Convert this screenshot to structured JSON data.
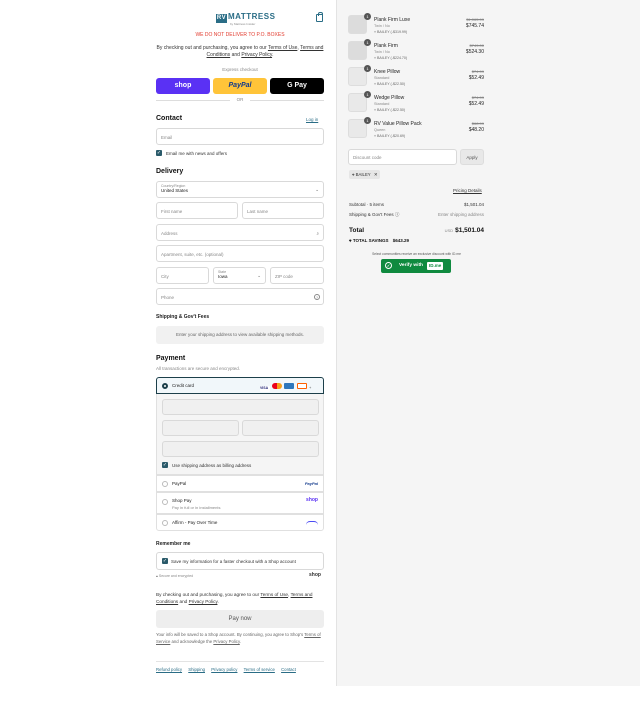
{
  "brand": {
    "name": "MATTRESS",
    "mark": "RV",
    "subtitle": "by Mattress Insider"
  },
  "notice": "WE DO NOT DELIVER TO P.O. BOXES",
  "agree_top": {
    "pre": "By checking out and purchasing, you agree to our",
    "terms": "Terms of Use",
    "mid": ", ",
    "terms2": "Terms and Conditions",
    "and": "and",
    "privacy": "Privacy Policy",
    "end": "."
  },
  "express": {
    "label": "Express checkout",
    "shop": "shop",
    "paypal": "PayPal",
    "gpay": "G Pay",
    "or": "OR"
  },
  "contact": {
    "title": "Contact",
    "login": "Log in",
    "email_placeholder": "Email",
    "news_label": "Email me with news and offers"
  },
  "delivery": {
    "title": "Delivery",
    "country_label": "Country/Region",
    "country_value": "United States",
    "first_name": "First name",
    "last_name": "Last name",
    "address": "Address",
    "apartment": "Apartment, suite, etc. (optional)",
    "city": "City",
    "state_label": "State",
    "state_value": "Iowa",
    "zip": "ZIP code",
    "phone": "Phone"
  },
  "shipping": {
    "title": "Shipping & Gov't Fees",
    "message": "Enter your shipping address to view available shipping methods."
  },
  "payment": {
    "title": "Payment",
    "subtitle": "All transactions are secure and encrypted.",
    "credit_card": "Credit card",
    "billing_label": "Use shipping address as billing address",
    "paypal": "PayPal",
    "shop_pay": "Shop Pay",
    "shop_pay_sub": "Pay in full or in installments",
    "affirm": "Affirm - Pay Over Time",
    "card_colors": [
      "#1a1f71",
      "#eb001b",
      "#2e77bc",
      "#ff6000"
    ]
  },
  "remember": {
    "title": "Remember me",
    "label": "Save my information for a faster checkout with a Shop account",
    "secure": "Secure and encrypted",
    "shop": "shop"
  },
  "agree_bottom": {
    "pre": "By checking out and purchasing, you agree to our",
    "terms": "Terms of Use",
    "and1": ", ",
    "terms2": "Terms and Conditions",
    "and": "and",
    "privacy": "Privacy Policy",
    "end": "."
  },
  "pay_now": "Pay now",
  "shop_info": {
    "pre": "Your info will be saved to a Shop account. By continuing, you agree to Shop's",
    "terms": "Terms of Service",
    "mid": "and acknowledge the",
    "privacy": "Privacy Policy",
    "end": "."
  },
  "footer_links": [
    "Refund policy",
    "Shipping",
    "Privacy policy",
    "Terms of service",
    "Contact"
  ],
  "cart": {
    "items": [
      {
        "qty": "1",
        "name": "Plank Firm Luxe",
        "variant": "Twin / No",
        "tag": "BAILEY (-$319.99)",
        "old": "$1,065.99",
        "price": "$745.74"
      },
      {
        "qty": "1",
        "name": "Plank Firm",
        "variant": "Twin / No",
        "tag": "BAILEY (-$224.70)",
        "old": "$749.00",
        "price": "$524.30"
      },
      {
        "qty": "1",
        "name": "Knee Pillow",
        "variant": "Standard",
        "tag": "BAILEY (-$22.50)",
        "old": "$74.99",
        "price": "$52.49"
      },
      {
        "qty": "1",
        "name": "Wedge Pillow",
        "variant": "Standard",
        "tag": "BAILEY (-$22.50)",
        "old": "$74.99",
        "price": "$52.49"
      },
      {
        "qty": "1",
        "name": "RV Value Pillow Pack",
        "variant": "Queen",
        "tag": "BAILEY (-$20.69)",
        "old": "$68.99",
        "price": "$48.20"
      }
    ],
    "discount_placeholder": "Discount code",
    "apply": "Apply",
    "code_chip": "BAILEY",
    "pricing_details": "Pricing Details",
    "subtotal_label": "Subtotal · 5 items",
    "subtotal_value": "$1,501.04",
    "shipping_label": "Shipping & Gov't Fees",
    "shipping_value": "Enter shipping address",
    "total_label": "Total",
    "currency": "USD",
    "total_value": "$1,501.04",
    "savings_label": "TOTAL SAVINGS",
    "savings_value": "$643.29",
    "idme_note": "Select communities receive an exclusive discount with ID.me",
    "idme_button": "Verify with",
    "idme_brand": "ID.me"
  }
}
